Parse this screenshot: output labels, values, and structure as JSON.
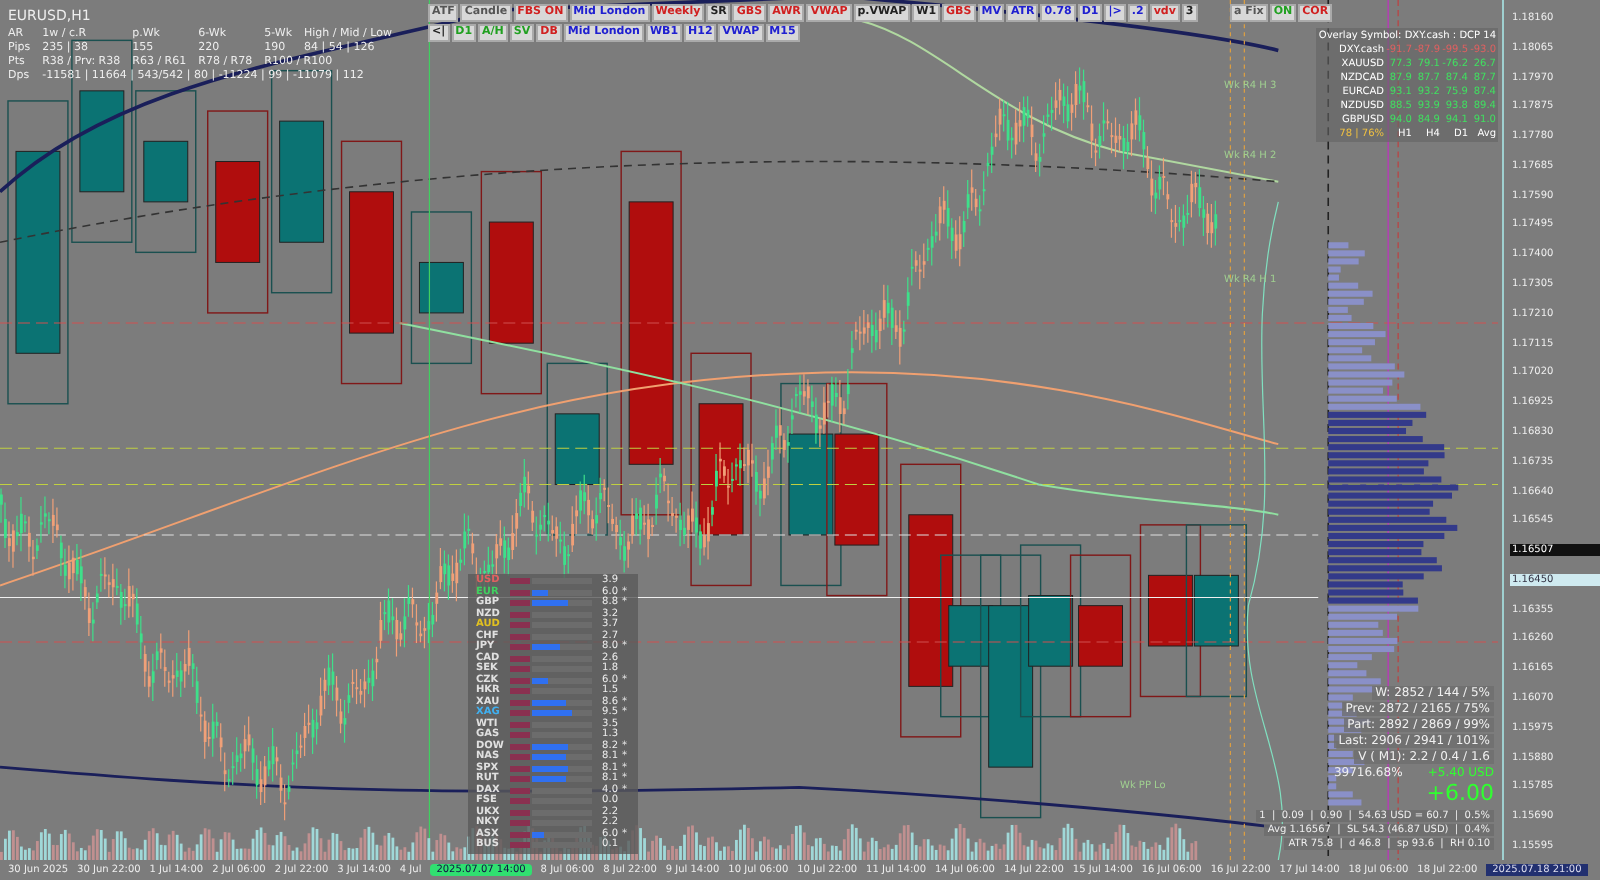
{
  "window": {
    "title": "EURUSD,H1"
  },
  "toolbar": [
    {
      "label": "ATF",
      "color": "#555555"
    },
    {
      "label": "Candle",
      "color": "#555555"
    },
    {
      "label": "FBS ON",
      "color": "#d02020"
    },
    {
      "label": "Mid London",
      "color": "#2020d0"
    },
    {
      "label": "Weekly",
      "color": "#d02020"
    },
    {
      "label": "SR",
      "color": "#222222"
    },
    {
      "label": "GBS",
      "color": "#d02020"
    },
    {
      "label": "AWR",
      "color": "#d02020"
    },
    {
      "label": "VWAP",
      "color": "#d02020"
    },
    {
      "label": "p.VWAP",
      "color": "#222222"
    },
    {
      "label": "W1",
      "color": "#222222"
    },
    {
      "label": "GBS",
      "color": "#d02020"
    },
    {
      "label": "MV",
      "color": "#2020d0"
    },
    {
      "label": "ATR",
      "color": "#2020d0"
    },
    {
      "label": "0.78",
      "color": "#2020d0"
    },
    {
      "label": "D1",
      "color": "#2020d0"
    },
    {
      "label": "|>",
      "color": "#2020d0"
    },
    {
      "label": ".2",
      "color": "#2020d0"
    },
    {
      "label": "vdv",
      "color": "#d02020"
    },
    {
      "label": "3",
      "color": "#222222"
    },
    {
      "label": "<|",
      "color": "#222222"
    },
    {
      "label": "D1",
      "color": "#20a020"
    },
    {
      "label": "A/H",
      "color": "#20a020"
    },
    {
      "label": "SV",
      "color": "#20a020"
    },
    {
      "label": "DB",
      "color": "#d02020"
    },
    {
      "label": "Mid London",
      "color": "#2020d0"
    },
    {
      "label": "WB1",
      "color": "#2020d0"
    },
    {
      "label": "H12",
      "color": "#2020d0"
    },
    {
      "label": "VWAP",
      "color": "#2020d0"
    },
    {
      "label": "M15",
      "color": "#2020d0"
    }
  ],
  "toolbar_right": [
    {
      "label": "a Fix",
      "color": "#555555"
    },
    {
      "label": "ON",
      "color": "#20a020"
    },
    {
      "label": "COR",
      "color": "#d02020"
    }
  ],
  "range_stats": {
    "header": [
      "AR",
      "1w / c.R",
      "p.Wk",
      "6-Wk",
      "5-Wk",
      "High / Mid / Low"
    ],
    "pips": [
      "Pips",
      "235 | 38",
      "155",
      "220",
      "190",
      "84 | 54 | 126"
    ],
    "pts": [
      "Pts",
      "R38 / Prv: R38",
      "R63 / R61",
      "R78 / R78",
      "R100 / R100"
    ],
    "dps": [
      "Dps",
      "-11581 | 11664 | 543/542 | 80 | -11224 | 99 | -11079 | 112"
    ]
  },
  "overlay": {
    "title": "Overlay Symbol: DXY.cash : DCP 14",
    "rows": [
      {
        "symbol": "DXY.cash",
        "color": "#e06060",
        "values": [
          "-91.7",
          "-87.9",
          "-99.5",
          "-93.0"
        ]
      },
      {
        "symbol": "XAUUSD",
        "color": "#40e060",
        "values": [
          "77.3",
          "79.1",
          "-76.2",
          "26.7"
        ]
      },
      {
        "symbol": "NZDCAD",
        "color": "#40e060",
        "values": [
          "87.9",
          "87.7",
          "87.4",
          "87.7"
        ]
      },
      {
        "symbol": "EURCAD",
        "color": "#40e060",
        "values": [
          "93.1",
          "93.2",
          "75.9",
          "87.4"
        ]
      },
      {
        "symbol": "NZDUSD",
        "color": "#40e060",
        "values": [
          "88.5",
          "93.9",
          "93.8",
          "89.4"
        ]
      },
      {
        "symbol": "GBPUSD",
        "color": "#40e060",
        "values": [
          "94.0",
          "84.9",
          "94.1",
          "91.0"
        ]
      }
    ],
    "footer": [
      "78 | 76%",
      "H1",
      "H4",
      "D1",
      "Avg"
    ]
  },
  "strength": [
    {
      "name": "USD",
      "color": "#e06060",
      "value": "3.9"
    },
    {
      "name": "EUR",
      "color": "#40d060",
      "level": 0.25,
      "value": "6.0",
      "flag": "*"
    },
    {
      "name": "GBP",
      "color": "#e0e0e0",
      "level": 0.6,
      "value": "8.8",
      "flag": "*"
    },
    {
      "name": "NZD",
      "color": "#e0e0e0",
      "value": "3.2"
    },
    {
      "name": "AUD",
      "color": "#e0c020",
      "value": "3.7"
    },
    {
      "name": "CHF",
      "color": "#e0e0e0",
      "value": "2.7"
    },
    {
      "name": "JPY",
      "color": "#e0e0e0",
      "level": 0.45,
      "value": "8.0",
      "flag": "*"
    },
    {
      "name": "CAD",
      "color": "#e0e0e0",
      "value": "2.6"
    },
    {
      "name": "SEK",
      "color": "#e0e0e0",
      "value": "1.8"
    },
    {
      "name": "CZK",
      "color": "#e0e0e0",
      "level": 0.25,
      "value": "6.0",
      "flag": "*"
    },
    {
      "name": "HKR",
      "color": "#e0e0e0",
      "value": "1.5"
    },
    {
      "name": "XAU",
      "color": "#e0e0e0",
      "level": 0.55,
      "value": "8.6",
      "flag": "*"
    },
    {
      "name": "XAG",
      "color": "#40b0f0",
      "level": 0.65,
      "value": "9.5",
      "flag": "*"
    },
    {
      "name": "WTI",
      "color": "#e0e0e0",
      "value": "3.5"
    },
    {
      "name": "GAS",
      "color": "#e0e0e0",
      "value": "1.3"
    },
    {
      "name": "DOW",
      "color": "#e0e0e0",
      "level": 0.6,
      "value": "8.2",
      "flag": "*"
    },
    {
      "name": "NAS",
      "color": "#e0e0e0",
      "level": 0.55,
      "value": "8.1",
      "flag": "*"
    },
    {
      "name": "SPX",
      "color": "#e0e0e0",
      "level": 0.6,
      "value": "8.1",
      "flag": "*"
    },
    {
      "name": "RUT",
      "color": "#e0e0e0",
      "level": 0.55,
      "value": "8.1",
      "flag": "*"
    },
    {
      "name": "DAX",
      "color": "#e0e0e0",
      "value": "4.0",
      "flag": "*"
    },
    {
      "name": "FSE",
      "color": "#e0e0e0",
      "value": "0.0"
    },
    {
      "name": "UKX",
      "color": "#e0e0e0",
      "value": "2.2"
    },
    {
      "name": "NKY",
      "color": "#e0e0e0",
      "value": "2.2"
    },
    {
      "name": "ASX",
      "color": "#e0e0e0",
      "level": 0.2,
      "value": "6.0",
      "flag": "*"
    },
    {
      "name": "BUS",
      "color": "#e0e0e0",
      "value": "0.1"
    }
  ],
  "chart_labels": [
    {
      "text": "Wk R4 H 3"
    },
    {
      "text": "Wk R4 H 2"
    },
    {
      "text": "Wk R4 H 1"
    },
    {
      "text": "Wk PP Lo"
    }
  ],
  "volume_stats": [
    "W: 2852 / 144 / 5%",
    "Prev: 2872 / 2165 / 75%",
    "Part: 2892 / 2869 / 99%",
    "Last: 2906 / 2941 / 101%",
    "V ( M1): 2.2 / 0.4 / 1.6"
  ],
  "pnl": {
    "percent": "39716.68%",
    "usd": "+5.40 USD",
    "big": "+6.00"
  },
  "trade_info": [
    "1  |  0.09  |  0.90  |  54.63 USD = 60.7  |  0.5%",
    "Avg 1.16567  |  SL 54.3 (46.87 USD)  |  0.4%",
    "ATR 75.8  |  d 46.8  |  sp 93.6  |  RH 0.10"
  ],
  "price_axis": [
    {
      "text": "1.18160",
      "kind": "tick"
    },
    {
      "text": "1.18065",
      "kind": "tick"
    },
    {
      "text": "1.17970",
      "kind": "tick"
    },
    {
      "text": "1.17875",
      "kind": "tick"
    },
    {
      "text": "1.17780",
      "kind": "tick"
    },
    {
      "text": "1.17685",
      "kind": "tick"
    },
    {
      "text": "1.17590",
      "kind": "tick"
    },
    {
      "text": "1.17495",
      "kind": "tick"
    },
    {
      "text": "1.17400",
      "kind": "tick"
    },
    {
      "text": "1.17305",
      "kind": "tick"
    },
    {
      "text": "1.17210",
      "kind": "tick"
    },
    {
      "text": "1.17115",
      "kind": "tick"
    },
    {
      "text": "1.17020",
      "kind": "tick"
    },
    {
      "text": "1.16925",
      "kind": "tick"
    },
    {
      "text": "1.16830",
      "kind": "tick"
    },
    {
      "text": "1.16735",
      "kind": "tick"
    },
    {
      "text": "1.16640",
      "kind": "tick"
    },
    {
      "text": "1.16545",
      "kind": "tick"
    },
    {
      "text": "1.16507",
      "kind": "bid"
    },
    {
      "text": "1.16450",
      "kind": "cursor"
    },
    {
      "text": "1.16355",
      "kind": "tick"
    },
    {
      "text": "1.16260",
      "kind": "tick"
    },
    {
      "text": "1.16165",
      "kind": "tick"
    },
    {
      "text": "1.16070",
      "kind": "tick"
    },
    {
      "text": "1.15975",
      "kind": "tick"
    },
    {
      "text": "1.15880",
      "kind": "tick"
    },
    {
      "text": "1.15785",
      "kind": "tick"
    },
    {
      "text": "1.15690",
      "kind": "tick"
    },
    {
      "text": "1.15595",
      "kind": "tick"
    }
  ],
  "time_axis": [
    {
      "text": "30 Jun 2025",
      "kind": "tick"
    },
    {
      "text": "30 Jun 22:00",
      "kind": "tick"
    },
    {
      "text": "1 Jul 14:00",
      "kind": "tick"
    },
    {
      "text": "2 Jul 06:00",
      "kind": "tick"
    },
    {
      "text": "2 Jul 22:00",
      "kind": "tick"
    },
    {
      "text": "3 Jul 14:00",
      "kind": "tick"
    },
    {
      "text": "4 Jul",
      "kind": "tick"
    },
    {
      "text": "2025.07.07 14:00",
      "kind": "cursor"
    },
    {
      "text": "8 Jul 06:00",
      "kind": "tick"
    },
    {
      "text": "8 Jul 22:00",
      "kind": "tick"
    },
    {
      "text": "9 Jul 14:00",
      "kind": "tick"
    },
    {
      "text": "10 Jul 06:00",
      "kind": "tick"
    },
    {
      "text": "10 Jul 22:00",
      "kind": "tick"
    },
    {
      "text": "11 Jul 14:00",
      "kind": "tick"
    },
    {
      "text": "14 Jul 06:00",
      "kind": "tick"
    },
    {
      "text": "14 Jul 22:00",
      "kind": "tick"
    },
    {
      "text": "15 Jul 14:00",
      "kind": "tick"
    },
    {
      "text": "16 Jul 06:00",
      "kind": "tick"
    },
    {
      "text": "16 Jul 22:00",
      "kind": "tick"
    },
    {
      "text": "17 Jul 14:00",
      "kind": "tick"
    },
    {
      "text": "18 Jul 06:00",
      "kind": "tick"
    },
    {
      "text": "18 Jul 22:00",
      "kind": "tick"
    },
    {
      "text": "2025.07.18 21:00",
      "kind": "end"
    }
  ]
}
